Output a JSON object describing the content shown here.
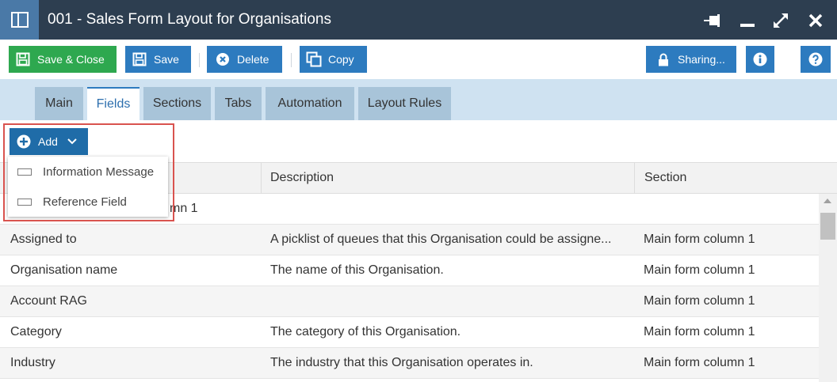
{
  "window": {
    "title": "001 - Sales Form Layout for Organisations",
    "app_icon": "layout-columns-icon",
    "controls": [
      "pin-icon",
      "minimize-icon",
      "maximize-icon",
      "close-icon"
    ]
  },
  "toolbar": {
    "save_close_label": "Save & Close",
    "save_label": "Save",
    "delete_label": "Delete",
    "copy_label": "Copy",
    "sharing_label": "Sharing...",
    "info_icon": "info-icon",
    "help_icon": "help-icon"
  },
  "tabs": [
    {
      "label": "Main",
      "active": false
    },
    {
      "label": "Fields",
      "active": true
    },
    {
      "label": "Sections",
      "active": false
    },
    {
      "label": "Tabs",
      "active": false
    },
    {
      "label": "Automation",
      "active": false
    },
    {
      "label": "Layout Rules",
      "active": false
    }
  ],
  "add_menu": {
    "button_label": "Add",
    "items": [
      {
        "label": "Information Message",
        "icon": "field-icon"
      },
      {
        "label": "Reference Field",
        "icon": "field-icon"
      }
    ]
  },
  "table": {
    "columns": [
      "Description",
      "Section"
    ],
    "partial_row_section": "mn 1",
    "rows": [
      {
        "name": "Assigned to",
        "description": "A picklist of queues that this Organisation could be assigne...",
        "section": "Main form column 1"
      },
      {
        "name": "Organisation name",
        "description": "The name of this Organisation.",
        "section": "Main form column 1"
      },
      {
        "name": "Account RAG",
        "description": "",
        "section": "Main form column 1"
      },
      {
        "name": "Category",
        "description": "The category of this Organisation.",
        "section": "Main form column 1"
      },
      {
        "name": "Industry",
        "description": "The industry that this Organisation operates in.",
        "section": "Main form column 1"
      }
    ]
  },
  "colors": {
    "titlebar": "#2d3e50",
    "green": "#2ea84f",
    "blue": "#2d7bbf",
    "highlight": "#d9534f"
  }
}
